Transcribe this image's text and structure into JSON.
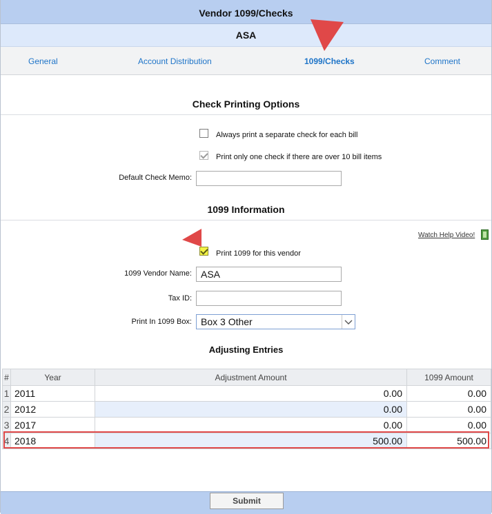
{
  "window": {
    "title": "Vendor 1099/Checks",
    "vendor_name": "ASA"
  },
  "tabs": [
    {
      "label": "General"
    },
    {
      "label": "Account Distribution"
    },
    {
      "label": "1099/Checks"
    },
    {
      "label": "Comment"
    }
  ],
  "check_printing": {
    "heading": "Check Printing Options",
    "separate_check": {
      "label": "Always print a separate check for each bill",
      "checked": false
    },
    "one_check": {
      "label": "Print only one check if there are over 10 bill items",
      "checked": true
    },
    "memo_label": "Default Check Memo:",
    "memo_value": ""
  },
  "info_1099": {
    "heading": "1099 Information",
    "help_link": "Watch Help Video!",
    "print_1099": {
      "label": "Print 1099 for this vendor",
      "checked": true
    },
    "vendor_name_label": "1099 Vendor Name:",
    "vendor_name_value": "ASA",
    "tax_id_label": "Tax ID:",
    "tax_id_value": "",
    "box_label": "Print In 1099 Box:",
    "box_value": "Box 3 Other"
  },
  "adjusting": {
    "heading": "Adjusting Entries",
    "columns": [
      "#",
      "Year",
      "Adjustment Amount",
      "1099 Amount"
    ],
    "rows": [
      {
        "n": "1",
        "year": "2011",
        "adjustment": "0.00",
        "amount": "0.00"
      },
      {
        "n": "2",
        "year": "2012",
        "adjustment": "0.00",
        "amount": "0.00"
      },
      {
        "n": "3",
        "year": "2017",
        "adjustment": "0.00",
        "amount": "0.00"
      },
      {
        "n": "4",
        "year": "2018",
        "adjustment": "500.00",
        "amount": "500.00"
      }
    ]
  },
  "footer": {
    "submit_label": "Submit"
  },
  "colors": {
    "header": "#b8cef0",
    "subheader": "#dde9fb",
    "link": "#1e74c8",
    "annotation": "#e04848"
  }
}
